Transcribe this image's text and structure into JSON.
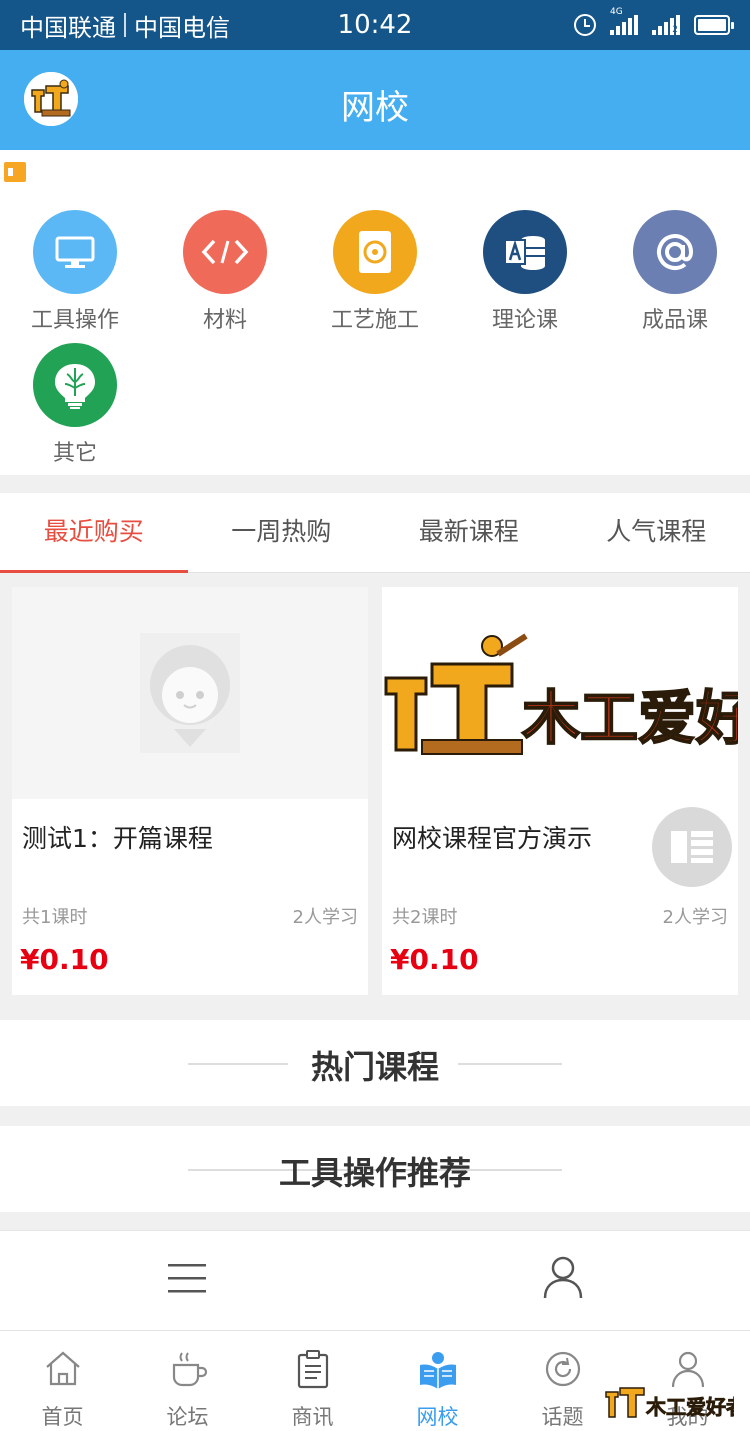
{
  "status_bar": {
    "carrier1": "中国联通",
    "carrier2": "中国电信",
    "time": "10:42",
    "network": "4G",
    "sim2_marker": "2"
  },
  "header": {
    "title": "网校",
    "logo_text": "木工"
  },
  "categories": [
    {
      "label": "工具操作",
      "icon": "monitor-icon",
      "color": "#5bb8f5"
    },
    {
      "label": "材料",
      "icon": "code-icon",
      "color": "#f06a5a"
    },
    {
      "label": "工艺施工",
      "icon": "disc-icon",
      "color": "#f2a81d"
    },
    {
      "label": "理论课",
      "icon": "office-doc-icon",
      "color": "#1f4f80"
    },
    {
      "label": "成品课",
      "icon": "at-icon",
      "color": "#6b7fb2"
    },
    {
      "label": "其它",
      "icon": "brain-bulb-icon",
      "color": "#22a254"
    }
  ],
  "tabs": [
    {
      "label": "最近购买",
      "active": true
    },
    {
      "label": "一周热购",
      "active": false
    },
    {
      "label": "最新课程",
      "active": false
    },
    {
      "label": "人气课程",
      "active": false
    }
  ],
  "courses": [
    {
      "title": "测试1：开篇课程",
      "lessons": "共1课时",
      "learners": "2人学习",
      "price": "¥0.10"
    },
    {
      "title": "网校课程官方演示",
      "lessons": "共2课时",
      "learners": "2人学习",
      "price": "¥0.10",
      "banner_text": "木工爱好者"
    }
  ],
  "sections": {
    "hot": "热门课程",
    "tools": "工具操作推荐"
  },
  "tabbar": [
    {
      "label": "首页",
      "icon": "home-icon",
      "active": false
    },
    {
      "label": "论坛",
      "icon": "coffee-cup-icon",
      "active": false
    },
    {
      "label": "商讯",
      "icon": "clipboard-icon",
      "active": false
    },
    {
      "label": "网校",
      "icon": "book-reader-icon",
      "active": true
    },
    {
      "label": "话题",
      "icon": "refresh-circle-icon",
      "active": false
    },
    {
      "label": "我的",
      "icon": "user-icon",
      "active": false
    }
  ],
  "watermark_text": "木工爱好者",
  "colors": {
    "status_bar": "#15568a",
    "header": "#45aef0",
    "accent_red": "#e84e40",
    "price_red": "#e60012",
    "active_blue": "#3a9df0"
  }
}
